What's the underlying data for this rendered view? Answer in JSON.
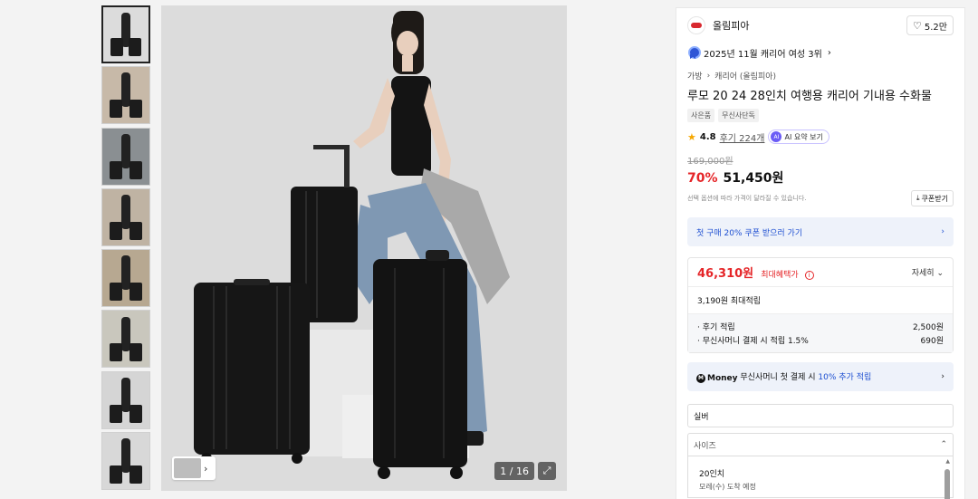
{
  "gallery": {
    "thumbnails": [
      {
        "bg": "#dcdcdc"
      },
      {
        "bg": "#c7b9a8"
      },
      {
        "bg": "#8a8f92"
      },
      {
        "bg": "#bfb3a3"
      },
      {
        "bg": "#b7a891"
      },
      {
        "bg": "#c9c7bd"
      },
      {
        "bg": "#d5d5d5"
      },
      {
        "bg": "#d8d8d8"
      }
    ],
    "counter": "1 / 16"
  },
  "brand": {
    "name": "올림피아",
    "likes": "5.2만"
  },
  "rank": "2025년 11월 캐리어 여성 3위",
  "breadcrumb": [
    "가방",
    "캐리어 (올림피아)"
  ],
  "title": "루모 20 24 28인치 여행용 캐리어 기내용 수화물",
  "tags": [
    "사은품",
    "무신사단독"
  ],
  "rating": {
    "score": "4.8",
    "reviews": "후기 224개",
    "ai_label": "AI 요약 보기"
  },
  "price": {
    "original": "169,000원",
    "discount": "70%",
    "current": "51,450원",
    "note": "선택 옵션에 따라 가격이 달라질 수 있습니다.",
    "coupon_btn": "쿠폰받기"
  },
  "first_purchase_banner": "첫 구매 20% 쿠폰 받으러 가기",
  "benefit": {
    "max_price": "46,310원",
    "max_label": "최대혜택가",
    "detail_btn": "자세히",
    "points_total": "3,190원 최대적립",
    "points": [
      {
        "label": "· 후기 적립",
        "value": "2,500원"
      },
      {
        "label": "· 무신사머니 결제 시 적립 1.5%",
        "value": "690원"
      }
    ]
  },
  "money_banner": {
    "logo": "Money",
    "text_a": "무신사머니 첫 결제 시",
    "text_b": "10% 추가 적립"
  },
  "options": {
    "color_value": "실버",
    "size_label": "사이즈",
    "size_option": "20인치",
    "size_option_sub": "모레(수) 도착 예정"
  }
}
